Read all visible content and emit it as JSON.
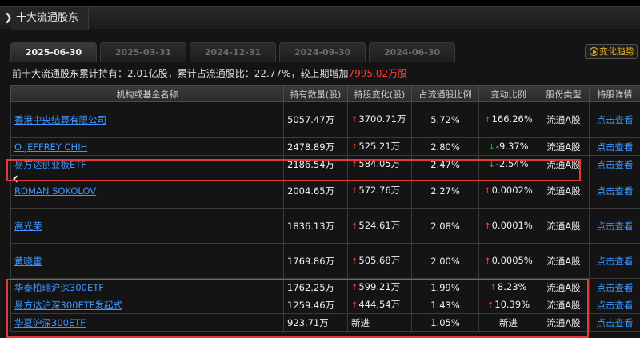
{
  "section": {
    "title": "十大流通股东"
  },
  "tabs": [
    {
      "label": "2025-06-30",
      "active": true
    },
    {
      "label": "2025-03-31",
      "active": false
    },
    {
      "label": "2024-12-31",
      "active": false
    },
    {
      "label": "2024-09-30",
      "active": false
    },
    {
      "label": "2024-06-30",
      "active": false
    }
  ],
  "trend_button": {
    "label": "变化趋势"
  },
  "summary": {
    "prefix": "前十大流通股东累计持有：",
    "holding": "2.01",
    "holding_unit": "亿股，累计占流通股比：",
    "ratio": "22.77%",
    "mid": "，较上期增加",
    "increase": "7995.02万股"
  },
  "table": {
    "headers": [
      "机构或基金名称",
      "持有数量(股)",
      "持股变化(股)",
      "占流通股比例",
      "变动比例",
      "股份类型",
      "持股详情"
    ],
    "rows": [
      {
        "name": "香港中央结算有限公司",
        "qty": "5057.47万",
        "chg": "3700.71万",
        "chg_dir": "up",
        "ratio": "5.72%",
        "var": "166.26%",
        "var_dir": "up",
        "type": "流通A股",
        "detail": "点击查看"
      },
      {
        "name": "O JEFFREY CHIH",
        "qty": "2478.89万",
        "chg": "525.21万",
        "chg_dir": "up",
        "ratio": "2.80%",
        "var": "-9.37%",
        "var_dir": "down",
        "type": "流通A股",
        "detail": "点击查看"
      },
      {
        "name": "易方达创业板ETF",
        "qty": "2186.54万",
        "chg": "584.05万",
        "chg_dir": "up",
        "ratio": "2.47%",
        "var": "-2.54%",
        "var_dir": "down",
        "type": "流通A股",
        "detail": "点击查看"
      },
      {
        "name": "ROMAN SOKOLOV",
        "qty": "2004.65万",
        "chg": "572.76万",
        "chg_dir": "up",
        "ratio": "2.27%",
        "var": "0.0002%",
        "var_dir": "up",
        "type": "流通A股",
        "detail": "点击查看"
      },
      {
        "name": "高光荣",
        "qty": "1836.13万",
        "chg": "524.61万",
        "chg_dir": "up",
        "ratio": "2.08%",
        "var": "0.0001%",
        "var_dir": "up",
        "type": "流通A股",
        "detail": "点击查看"
      },
      {
        "name": "黄晓雷",
        "qty": "1769.86万",
        "chg": "505.68万",
        "chg_dir": "up",
        "ratio": "2.00%",
        "var": "0.0005%",
        "var_dir": "up",
        "type": "流通A股",
        "detail": "点击查看"
      },
      {
        "name": "华泰柏瑞沪深300ETF",
        "qty": "1762.25万",
        "chg": "599.21万",
        "chg_dir": "up",
        "ratio": "1.99%",
        "var": "8.23%",
        "var_dir": "up",
        "type": "流通A股",
        "detail": "点击查看"
      },
      {
        "name": "易方达沪深300ETF发起式",
        "qty": "1259.46万",
        "chg": "444.54万",
        "chg_dir": "up",
        "ratio": "1.43%",
        "var": "10.39%",
        "var_dir": "up",
        "type": "流通A股",
        "detail": "点击查看"
      },
      {
        "name": "华夏沪深300ETF",
        "qty": "923.71万",
        "chg": "新进",
        "chg_dir": "new",
        "ratio": "1.05%",
        "var": "新进",
        "var_dir": "new",
        "type": "流通A股",
        "detail": "点击查看"
      }
    ]
  },
  "colors": {
    "accent_up": "#ff3b30",
    "accent_down": "#22c02a",
    "link": "#3d96ff",
    "highlight_box": "#e23a3a"
  }
}
